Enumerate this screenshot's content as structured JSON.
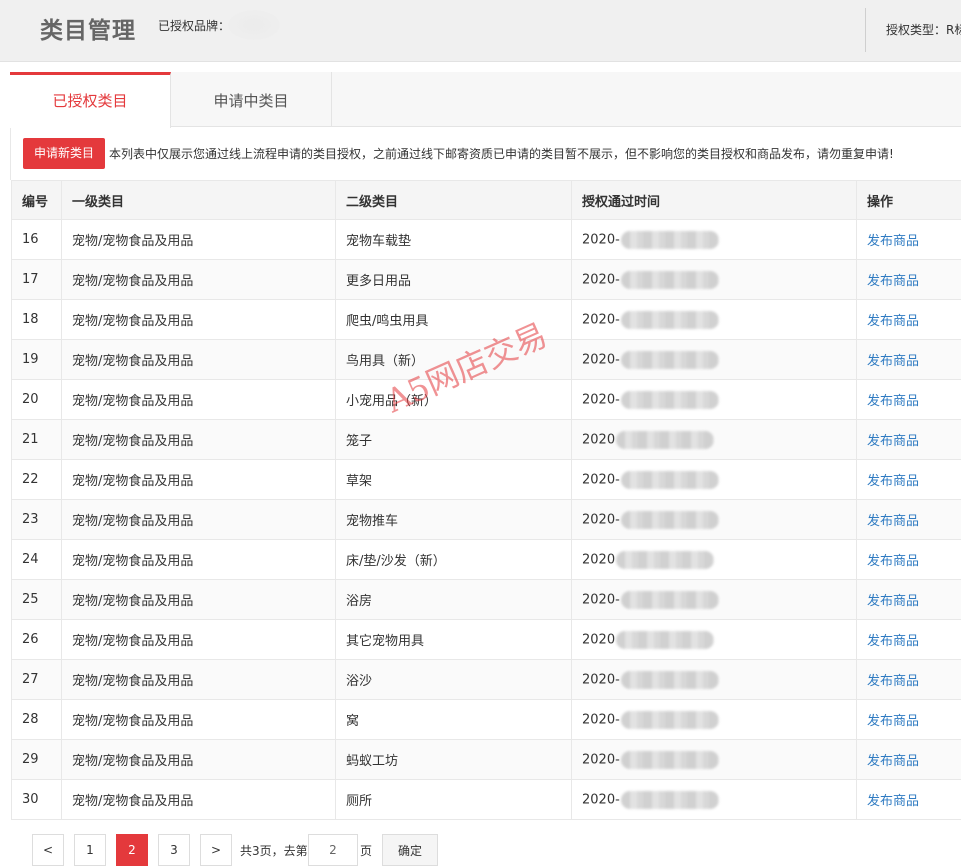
{
  "header": {
    "title": "类目管理",
    "brand_label": "已授权品牌：",
    "auth_type_label": "授权类型：R标"
  },
  "tabs": [
    {
      "label": "已授权类目",
      "active": true
    },
    {
      "label": "申请中类目",
      "active": false
    }
  ],
  "notice": {
    "apply_button": "申请新类目",
    "text": "本列表中仅展示您通过线上流程申请的类目授权，之前通过线下邮寄资质已申请的类目暂不展示，但不影响您的类目授权和商品发布，请勿重复申请!"
  },
  "table": {
    "columns": [
      "编号",
      "一级类目",
      "二级类目",
      "授权通过时间",
      "操作"
    ],
    "rows": [
      {
        "id": "16",
        "level1": "宠物/宠物食品及用品",
        "level2": "宠物车载垫",
        "date_prefix": "2020-",
        "action": "发布商品"
      },
      {
        "id": "17",
        "level1": "宠物/宠物食品及用品",
        "level2": "更多日用品",
        "date_prefix": "2020-",
        "action": "发布商品"
      },
      {
        "id": "18",
        "level1": "宠物/宠物食品及用品",
        "level2": "爬虫/鸣虫用具",
        "date_prefix": "2020-",
        "action": "发布商品"
      },
      {
        "id": "19",
        "level1": "宠物/宠物食品及用品",
        "level2": "鸟用具（新）",
        "date_prefix": "2020-",
        "action": "发布商品"
      },
      {
        "id": "20",
        "level1": "宠物/宠物食品及用品",
        "level2": "小宠用品（新）",
        "date_prefix": "2020-",
        "action": "发布商品"
      },
      {
        "id": "21",
        "level1": "宠物/宠物食品及用品",
        "level2": "笼子",
        "date_prefix": "2020",
        "action": "发布商品"
      },
      {
        "id": "22",
        "level1": "宠物/宠物食品及用品",
        "level2": "草架",
        "date_prefix": "2020-",
        "action": "发布商品"
      },
      {
        "id": "23",
        "level1": "宠物/宠物食品及用品",
        "level2": "宠物推车",
        "date_prefix": "2020-",
        "action": "发布商品"
      },
      {
        "id": "24",
        "level1": "宠物/宠物食品及用品",
        "level2": "床/垫/沙发（新）",
        "date_prefix": "2020",
        "action": "发布商品"
      },
      {
        "id": "25",
        "level1": "宠物/宠物食品及用品",
        "level2": "浴房",
        "date_prefix": "2020-",
        "action": "发布商品"
      },
      {
        "id": "26",
        "level1": "宠物/宠物食品及用品",
        "level2": "其它宠物用具",
        "date_prefix": "2020",
        "action": "发布商品"
      },
      {
        "id": "27",
        "level1": "宠物/宠物食品及用品",
        "level2": "浴沙",
        "date_prefix": "2020-",
        "action": "发布商品"
      },
      {
        "id": "28",
        "level1": "宠物/宠物食品及用品",
        "level2": "窝",
        "date_prefix": "2020-",
        "action": "发布商品"
      },
      {
        "id": "29",
        "level1": "宠物/宠物食品及用品",
        "level2": "蚂蚁工坊",
        "date_prefix": "2020-",
        "action": "发布商品"
      },
      {
        "id": "30",
        "level1": "宠物/宠物食品及用品",
        "level2": "厕所",
        "date_prefix": "2020-",
        "action": "发布商品"
      }
    ]
  },
  "pagination": {
    "prev": "<",
    "pages": [
      "1",
      "2",
      "3"
    ],
    "current": "2",
    "next": ">",
    "total_text": "共3页，去第",
    "page_suffix": "页",
    "jump_value": "2",
    "confirm": "确定"
  },
  "watermark": "A5网店交易",
  "colors": {
    "accent": "#e4393c",
    "link": "#2f7bc2"
  }
}
